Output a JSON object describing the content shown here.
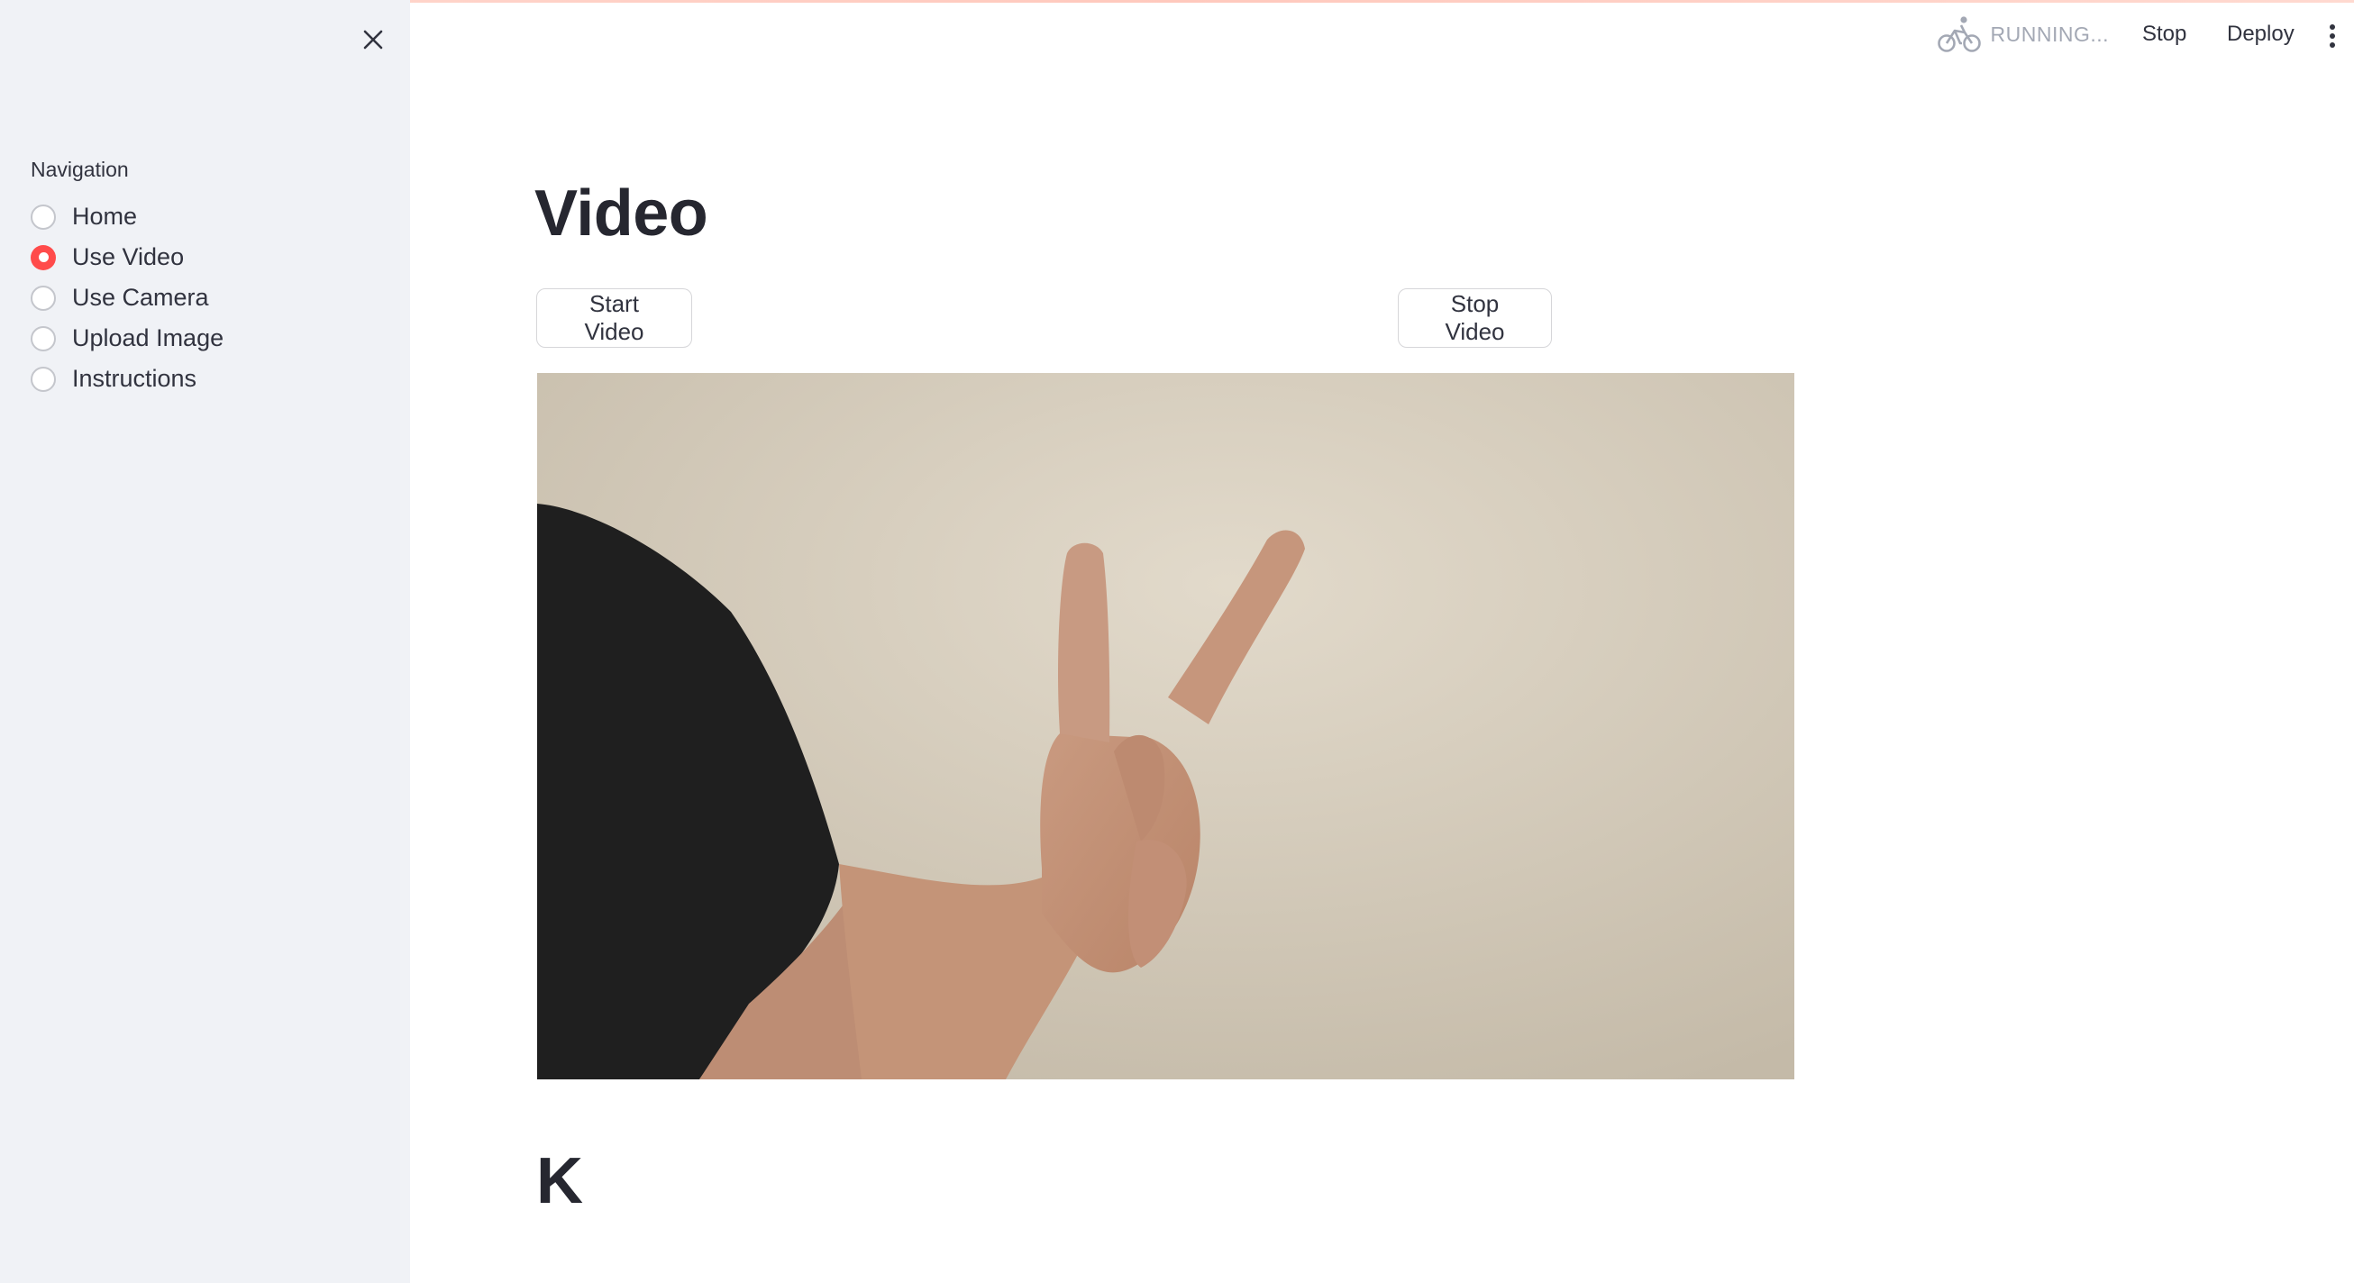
{
  "header": {
    "status_text": "RUNNING...",
    "stop_label": "Stop",
    "deploy_label": "Deploy"
  },
  "sidebar": {
    "nav_label": "Navigation",
    "items": [
      {
        "label": "Home",
        "selected": false
      },
      {
        "label": "Use Video",
        "selected": true
      },
      {
        "label": "Use Camera",
        "selected": false
      },
      {
        "label": "Upload Image",
        "selected": false
      },
      {
        "label": "Instructions",
        "selected": false
      }
    ]
  },
  "main": {
    "title": "Video",
    "start_button": "Start Video",
    "stop_button": "Stop Video",
    "prediction": "K"
  },
  "colors": {
    "accent": "#ff4b4b",
    "sidebar_bg": "#f0f2f6",
    "text": "#31333f"
  }
}
